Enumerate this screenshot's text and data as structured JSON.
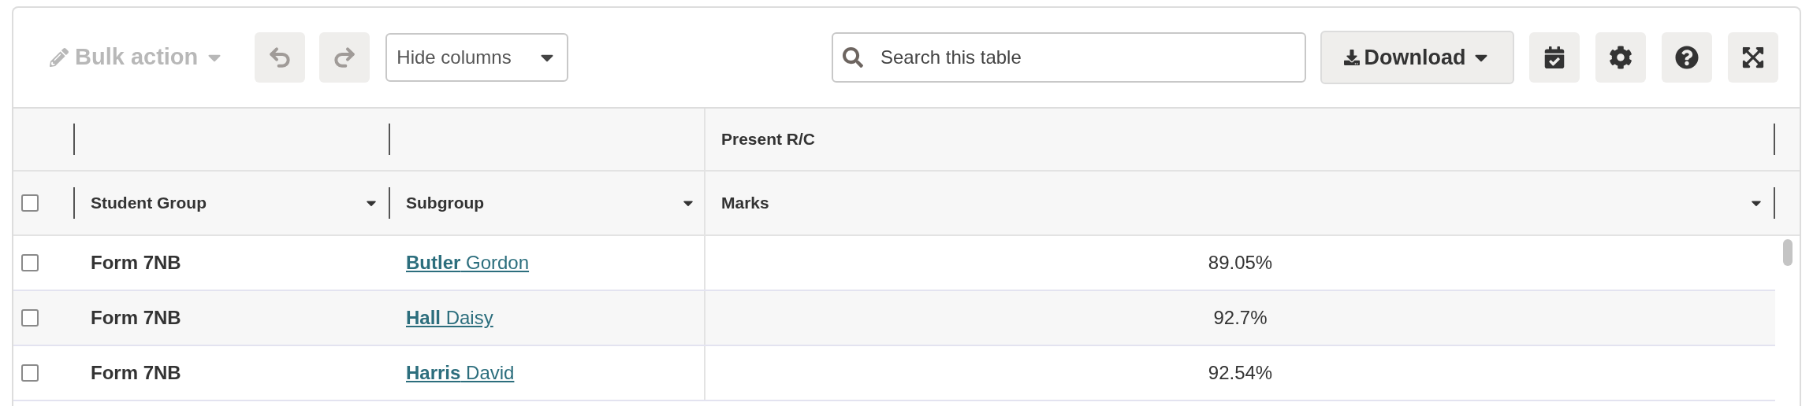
{
  "toolbar": {
    "bulk_action": {
      "label": "Bulk action",
      "disabled": true
    },
    "hide_columns": {
      "label": "Hide columns"
    },
    "search": {
      "placeholder": "Search this table"
    },
    "download": {
      "label": "Download"
    }
  },
  "table": {
    "group_header": {
      "label": "Present R/C"
    },
    "select_all": {
      "checked": false
    },
    "columns": [
      {
        "label": "Student Group"
      },
      {
        "label": "Subgroup"
      },
      {
        "label": "Marks"
      }
    ],
    "rows": [
      {
        "checked": false,
        "student_group": "Form 7NB",
        "subgroup": "**Butler** Gordon",
        "marks": "89.05%"
      },
      {
        "checked": false,
        "student_group": "Form 7NB",
        "subgroup": "**Hall** Daisy",
        "marks": "92.7%"
      },
      {
        "checked": false,
        "student_group": "Form 7NB",
        "subgroup": "**Harris** David",
        "marks": "92.54%"
      }
    ]
  }
}
